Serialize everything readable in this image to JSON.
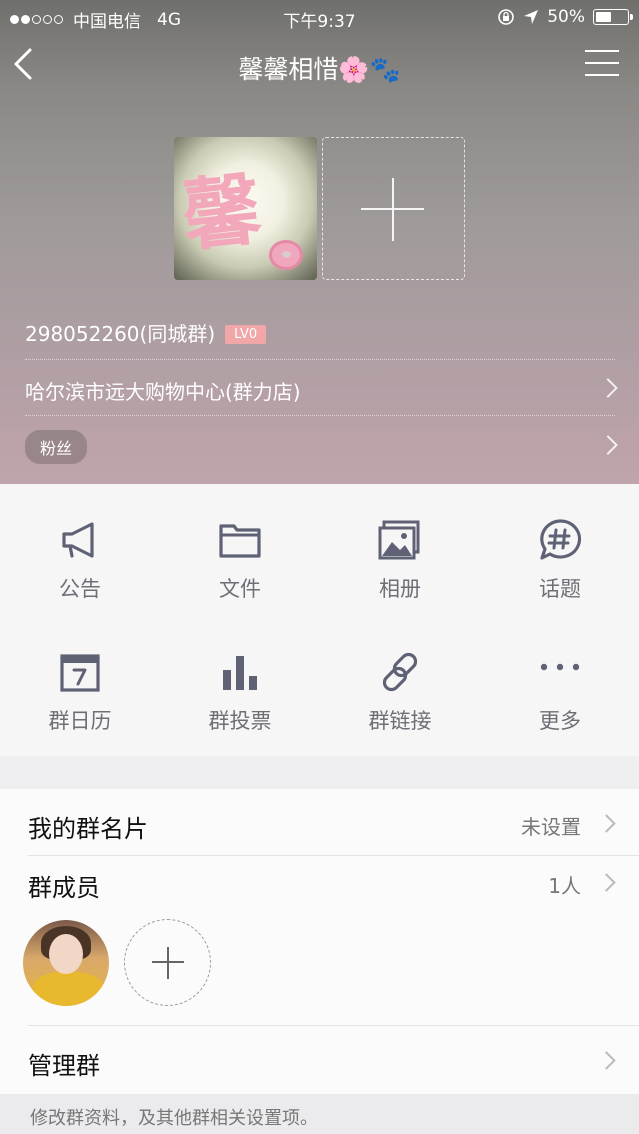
{
  "status_bar": {
    "carrier": "中国电信",
    "network": "4G",
    "time": "下午9:37",
    "battery": "50%",
    "battery_level": 0.5,
    "signal_strength": 2
  },
  "nav": {
    "title": "馨馨相惜🌸🐾"
  },
  "group": {
    "id_line": "298052260(同城群)",
    "level": "LV0",
    "location": "哈尔滨市远大购物中心(群力店)",
    "tag": "粉丝"
  },
  "features": [
    {
      "label": "公告",
      "icon": "megaphone-icon"
    },
    {
      "label": "文件",
      "icon": "folder-icon"
    },
    {
      "label": "相册",
      "icon": "photo-album-icon"
    },
    {
      "label": "话题",
      "icon": "topic-hashtag-icon"
    },
    {
      "label": "群日历",
      "icon": "calendar-icon"
    },
    {
      "label": "群投票",
      "icon": "vote-bars-icon"
    },
    {
      "label": "群链接",
      "icon": "link-icon"
    },
    {
      "label": "更多",
      "icon": "more-dots-icon"
    }
  ],
  "list": {
    "card": {
      "title": "我的群名片",
      "value": "未设置"
    },
    "members": {
      "title": "群成员",
      "value": "1人"
    },
    "manage": {
      "title": "管理群"
    }
  },
  "footer": {
    "hint": "修改群资料，及其他群相关设置项。"
  },
  "colors": {
    "icon": "#5f6275",
    "label": "#6e6e76",
    "level_badge": "#f1a7a7"
  }
}
